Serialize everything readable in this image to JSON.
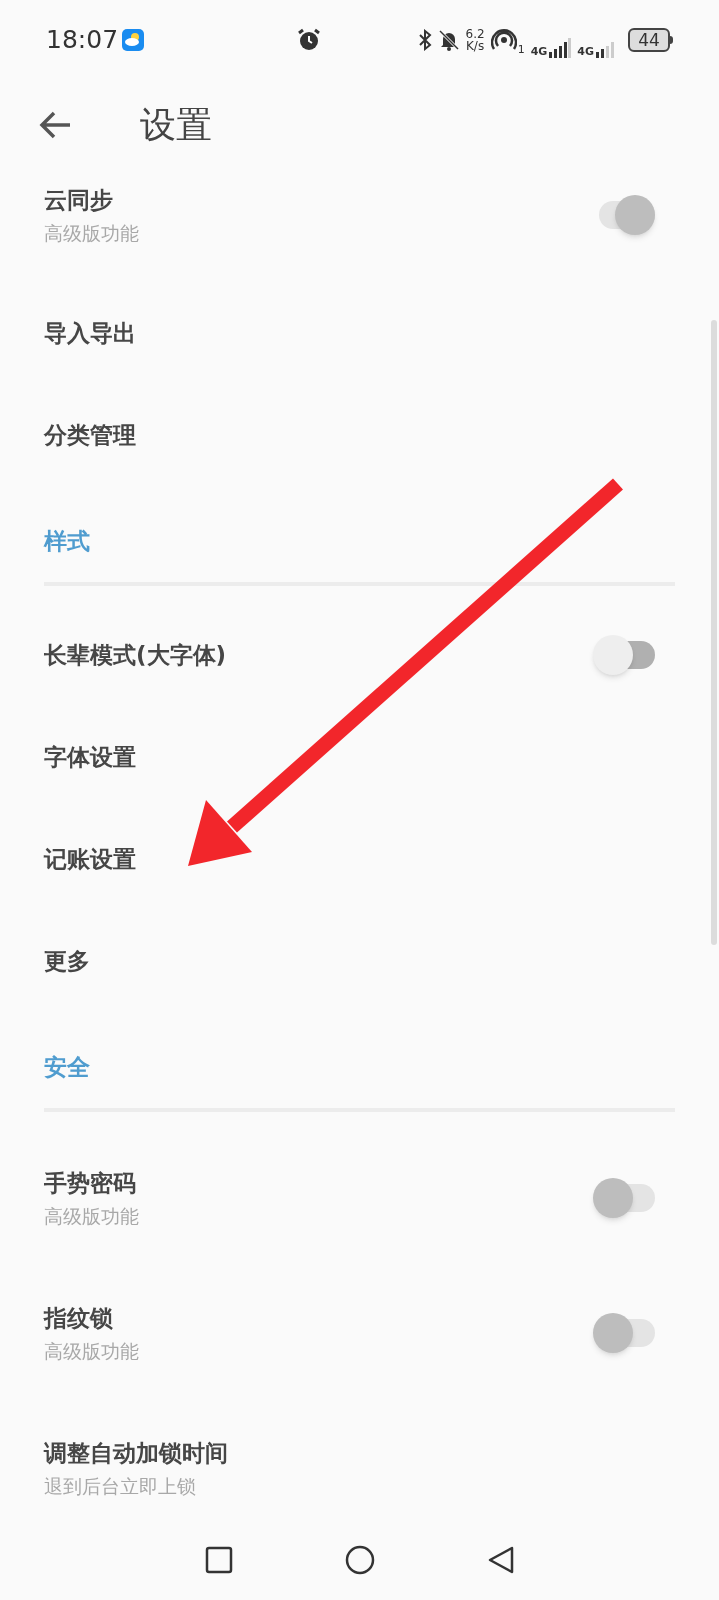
{
  "status_bar": {
    "time": "18:07",
    "speed_value": "6.2",
    "speed_unit": "K/s",
    "hotspot_count": "1",
    "sim1": "4G",
    "sim2": "4G",
    "battery": "44"
  },
  "header": {
    "title": "设置"
  },
  "sections": [
    {
      "items": [
        {
          "kind": "toggle",
          "title": "云同步",
          "subtitle": "高级版功能",
          "on": true,
          "disabled": true
        },
        {
          "kind": "plain",
          "title": "导入导出"
        },
        {
          "kind": "plain",
          "title": "分类管理"
        }
      ]
    },
    {
      "title": "样式",
      "items": [
        {
          "kind": "toggle",
          "title": "长辈模式(大字体)",
          "on": false,
          "disabled": false
        },
        {
          "kind": "plain",
          "title": "字体设置"
        },
        {
          "kind": "plain",
          "title": "记账设置"
        },
        {
          "kind": "plain",
          "title": "更多"
        }
      ]
    },
    {
      "title": "安全",
      "items": [
        {
          "kind": "toggle",
          "title": "手势密码",
          "subtitle": "高级版功能",
          "on": false,
          "disabled": true
        },
        {
          "kind": "toggle",
          "title": "指纹锁",
          "subtitle": "高级版功能",
          "on": false,
          "disabled": true
        },
        {
          "kind": "plain",
          "title": "调整自动加锁时间",
          "subtitle": "退到后台立即上锁"
        }
      ]
    }
  ]
}
